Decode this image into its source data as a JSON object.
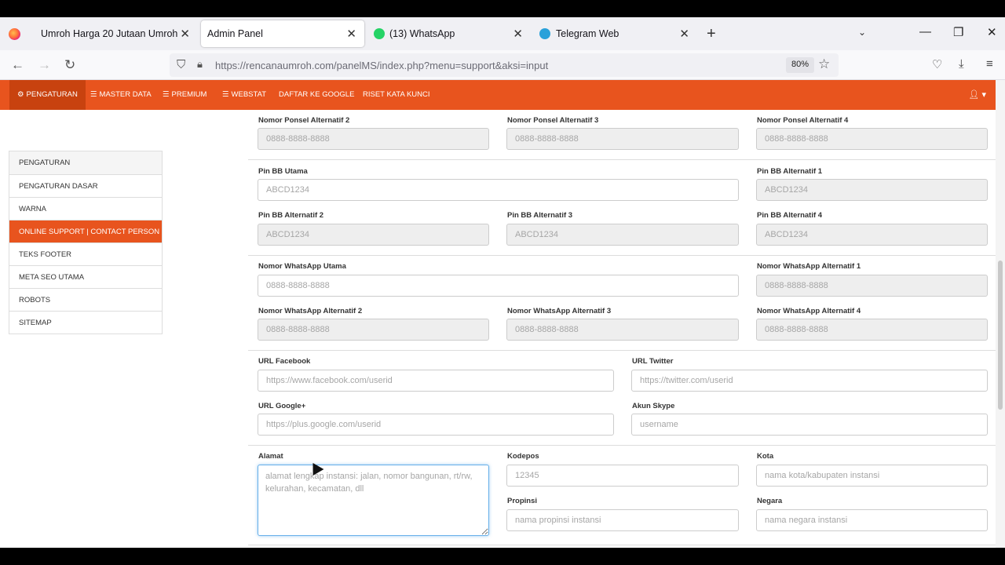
{
  "browser": {
    "tabs": [
      {
        "title": "Umroh Harga 20 Jutaan Umroh",
        "active": false
      },
      {
        "title": "Admin Panel",
        "active": true
      },
      {
        "title": "(13) WhatsApp",
        "active": false
      },
      {
        "title": "Telegram Web",
        "active": false
      }
    ],
    "url": "https://rencanaumroh.com/panelMS/index.php?menu=support&aksi=input",
    "zoom": "80%"
  },
  "nav": {
    "items": [
      {
        "label": "PENGATURAN",
        "icon": "gear-icon"
      },
      {
        "label": "MASTER DATA",
        "icon": "list-icon"
      },
      {
        "label": "PREMIUM",
        "icon": "list-icon"
      },
      {
        "label": "WEBSTAT",
        "icon": "list-icon"
      },
      {
        "label": "DAFTAR KE GOOGLE",
        "icon": ""
      },
      {
        "label": "RISET KATA KUNCI",
        "icon": ""
      }
    ]
  },
  "sidebar": {
    "items": [
      "PENGATURAN",
      "PENGATURAN DASAR",
      "WARNA",
      "ONLINE SUPPORT | CONTACT PERSON",
      "TEKS FOOTER",
      "META SEO UTAMA",
      "ROBOTS",
      "SITEMAP"
    ]
  },
  "form": {
    "ponsel_alt2": {
      "label": "Nomor Ponsel Alternatif 2",
      "placeholder": "0888-8888-8888"
    },
    "ponsel_alt3": {
      "label": "Nomor Ponsel Alternatif 3",
      "placeholder": "0888-8888-8888"
    },
    "ponsel_alt4": {
      "label": "Nomor Ponsel Alternatif 4",
      "placeholder": "0888-8888-8888"
    },
    "pinbb_utama": {
      "label": "Pin BB Utama",
      "placeholder": "ABCD1234"
    },
    "pinbb_alt1": {
      "label": "Pin BB Alternatif 1",
      "placeholder": "ABCD1234"
    },
    "pinbb_alt2": {
      "label": "Pin BB Alternatif 2",
      "placeholder": "ABCD1234"
    },
    "pinbb_alt3": {
      "label": "Pin BB Alternatif 3",
      "placeholder": "ABCD1234"
    },
    "pinbb_alt4": {
      "label": "Pin BB Alternatif 4",
      "placeholder": "ABCD1234"
    },
    "wa_utama": {
      "label": "Nomor WhatsApp Utama",
      "placeholder": "0888-8888-8888"
    },
    "wa_alt1": {
      "label": "Nomor WhatsApp Alternatif 1",
      "placeholder": "0888-8888-8888"
    },
    "wa_alt2": {
      "label": "Nomor WhatsApp Alternatif 2",
      "placeholder": "0888-8888-8888"
    },
    "wa_alt3": {
      "label": "Nomor WhatsApp Alternatif 3",
      "placeholder": "0888-8888-8888"
    },
    "wa_alt4": {
      "label": "Nomor WhatsApp Alternatif 4",
      "placeholder": "0888-8888-8888"
    },
    "facebook": {
      "label": "URL Facebook",
      "placeholder": "https://www.facebook.com/userid"
    },
    "twitter": {
      "label": "URL Twitter",
      "placeholder": "https://twitter.com/userid"
    },
    "googleplus": {
      "label": "URL Google+",
      "placeholder": "https://plus.google.com/userid"
    },
    "skype": {
      "label": "Akun Skype",
      "placeholder": "username"
    },
    "alamat": {
      "label": "Alamat",
      "placeholder": "alamat lengkap instansi: jalan, nomor bangunan, rt/rw, kelurahan, kecamatan, dll"
    },
    "kodepos": {
      "label": "Kodepos",
      "placeholder": "12345"
    },
    "kota": {
      "label": "Kota",
      "placeholder": "nama kota/kabupaten instansi"
    },
    "propinsi": {
      "label": "Propinsi",
      "placeholder": "nama propinsi instansi"
    },
    "negara": {
      "label": "Negara",
      "placeholder": "nama negara instansi"
    }
  }
}
